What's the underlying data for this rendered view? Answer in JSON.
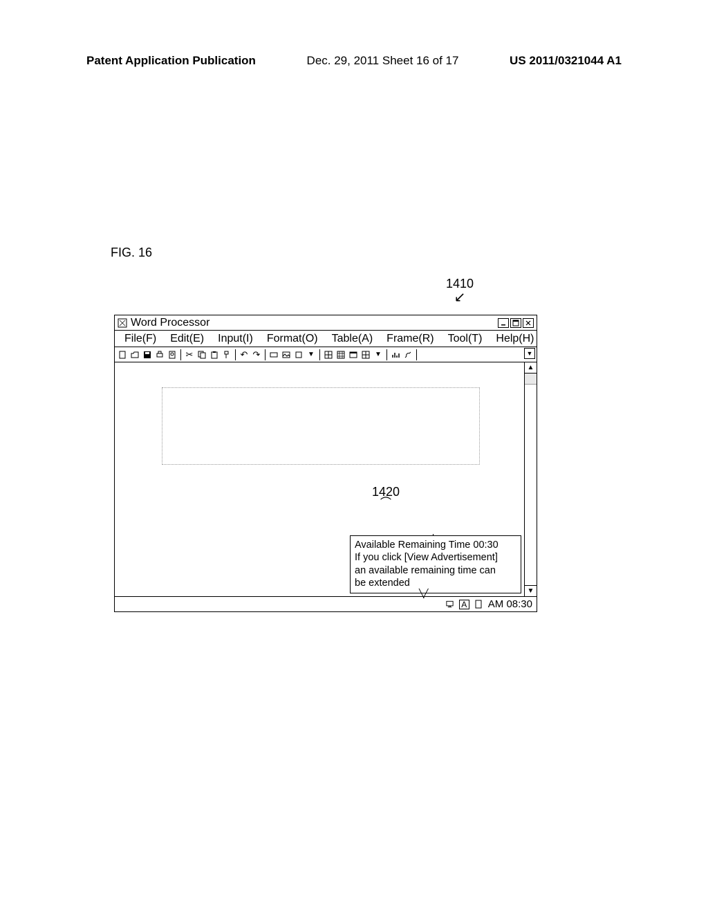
{
  "page_header": {
    "left": "Patent Application Publication",
    "center": "Dec. 29, 2011  Sheet 16 of 17",
    "right": "US 2011/0321044 A1"
  },
  "figure_label": "FIG. 16",
  "callouts": {
    "ref_window": "1410",
    "ref_tooltip": "1420"
  },
  "app": {
    "title": "Word Processor",
    "window_controls": {
      "minimize": "–",
      "maximize": "❐",
      "close": "✕"
    },
    "menu": {
      "file": "File(F)",
      "edit": "Edit(E)",
      "input": "Input(I)",
      "format": "Format(O)",
      "table": "Table(A)",
      "frame": "Frame(R)",
      "tool": "Tool(T)",
      "help": "Help(H)"
    },
    "tooltip": {
      "line1": "Available Remaining Time  00:30",
      "line2": "If you click [View Advertisement]",
      "line3": "an available remaining time can",
      "line4": "be extended"
    },
    "taskbar": {
      "time": "AM 08:30"
    }
  }
}
